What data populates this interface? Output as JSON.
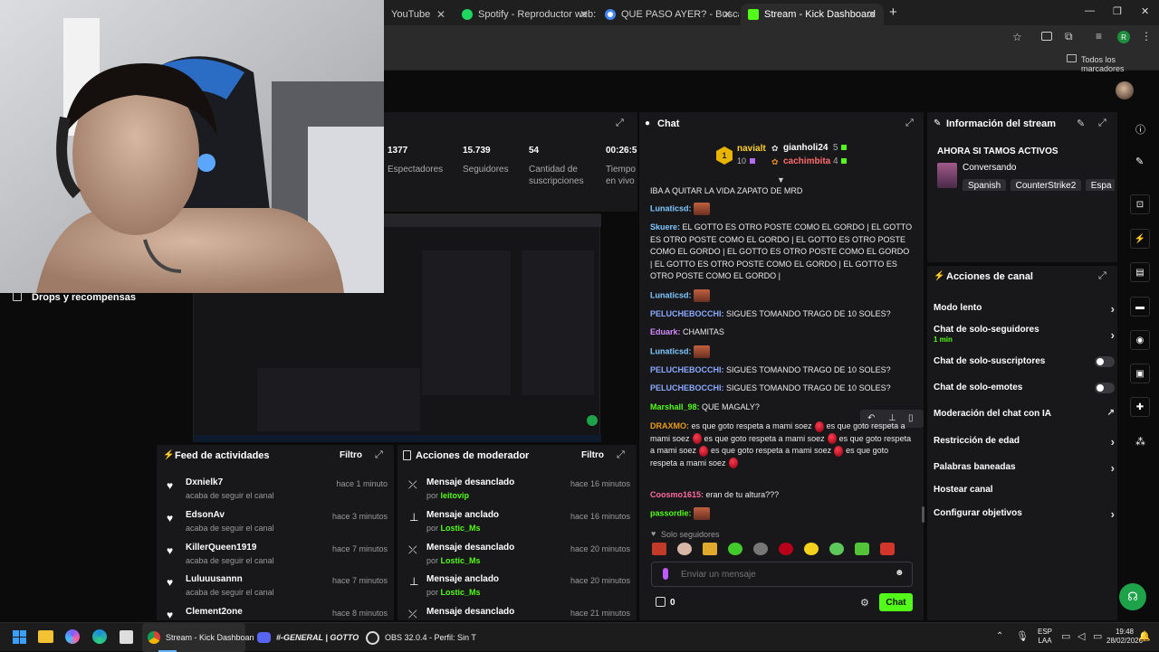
{
  "browser": {
    "tabs": [
      {
        "label": "YouTube"
      },
      {
        "label": "Spotify - Reproductor web: mú"
      },
      {
        "label": "QUE PASO AYER? - Buscar con"
      },
      {
        "label": "Stream - Kick Dashboard"
      }
    ],
    "bookmarks_label": "Todos los marcadores",
    "profile_initial": "R"
  },
  "stats": [
    {
      "value": "1377",
      "label": "Espectadores"
    },
    {
      "value": "15.739",
      "label": "Seguidores"
    },
    {
      "value": "54",
      "label": "Cantidad de suscripciones"
    },
    {
      "value": "00:26:5",
      "label": "Tiempo en vivo"
    }
  ],
  "drops_label": "Drops y recompensas",
  "chat": {
    "title": "Chat",
    "leaderboard": [
      {
        "rank": "1",
        "name": "navialt",
        "count": "10"
      },
      {
        "name": "gianholi24",
        "count": "5"
      },
      {
        "name": "cachimbita",
        "count": "4"
      }
    ],
    "messages": [
      {
        "user": "",
        "text": "IBA A QUITAR LA VIDA ZAPATO DE MRD"
      },
      {
        "user": "Lunaticsd:",
        "text": ""
      },
      {
        "user": "Skuere:",
        "text": "EL GOTTO ES OTRO POSTE COMO EL GORDO | EL GOTTO ES OTRO POSTE COMO EL GORDO | EL GOTTO ES OTRO POSTE COMO EL GORDO | EL GOTTO ES OTRO POSTE COMO EL GORDO | EL GOTTO ES OTRO POSTE COMO EL GORDO | EL GOTTO ES OTRO POSTE COMO EL GORDO |"
      },
      {
        "user": "Lunaticsd:",
        "text": ""
      },
      {
        "user": "PELUCHEBOCCHI:",
        "text": "SIGUES TOMANDO TRAGO DE 10 SOLES?"
      },
      {
        "user": "Eduark:",
        "text": "CHAMITAS"
      },
      {
        "user": "Lunaticsd:",
        "text": ""
      },
      {
        "user": "PELUCHEBOCCHI:",
        "text": "SIGUES TOMANDO TRAGO DE 10 SOLES?"
      },
      {
        "user": "PELUCHEBOCCHI:",
        "text": "SIGUES TOMANDO TRAGO DE 10 SOLES?"
      },
      {
        "user": "Marshall_98:",
        "text": "QUE MAGALY?"
      },
      {
        "user": "DRAXMO:",
        "text": "es que goto respeta a mami soez"
      },
      {
        "user": "Coosmo1615:",
        "text": "eran de tu altura???"
      },
      {
        "user": "passordie:",
        "text": ""
      }
    ],
    "followers_only": "Solo seguidores",
    "input_placeholder": "Enviar un mensaje",
    "points": "0",
    "send_label": "Chat"
  },
  "stream_info": {
    "title": "Información del stream",
    "stream_title": "AHORA SI TAMOS ACTIVOS",
    "category": "Conversando",
    "tags": [
      "Spanish",
      "CounterStrike2",
      "Espa"
    ]
  },
  "channel_actions": {
    "title": "Acciones de canal",
    "items": [
      {
        "label": "Modo lento",
        "control": "chevron"
      },
      {
        "label": "Chat de solo-seguidores",
        "sub": "1 min",
        "control": "chevron"
      },
      {
        "label": "Chat de solo-suscriptores",
        "control": "toggle"
      },
      {
        "label": "Chat de solo-emotes",
        "control": "toggle"
      },
      {
        "label": "Moderación del chat con IA",
        "control": "external"
      },
      {
        "label": "Restricción de edad",
        "control": "chevron"
      },
      {
        "label": "Palabras baneadas",
        "control": "chevron"
      },
      {
        "label": "Hostear canal",
        "control": "none"
      },
      {
        "label": "Configurar objetivos",
        "control": "chevron"
      }
    ]
  },
  "activity_feed": {
    "title": "Feed de actividades",
    "filter": "Filtro",
    "items": [
      {
        "name": "Dxnielk7",
        "action": "acaba de seguir el canal",
        "time": "hace 1 minuto"
      },
      {
        "name": "EdsonAv",
        "action": "acaba de seguir el canal",
        "time": "hace 3 minutos"
      },
      {
        "name": "KillerQueen1919",
        "action": "acaba de seguir el canal",
        "time": "hace 7 minutos"
      },
      {
        "name": "Luluuusannn",
        "action": "acaba de seguir el canal",
        "time": "hace 7 minutos"
      },
      {
        "name": "Clement2one",
        "action": "",
        "time": "hace 8 minutos"
      }
    ]
  },
  "mod_actions": {
    "title": "Acciones de moderador",
    "filter": "Filtro",
    "items": [
      {
        "action": "Mensaje desanclado",
        "by_prefix": "por",
        "by": "leitovip",
        "time": "hace 16 minutos"
      },
      {
        "action": "Mensaje anclado",
        "by_prefix": "por",
        "by": "Lostic_Ms",
        "time": "hace 16 minutos"
      },
      {
        "action": "Mensaje desanclado",
        "by_prefix": "por",
        "by": "Lostic_Ms",
        "time": "hace 20 minutos"
      },
      {
        "action": "Mensaje anclado",
        "by_prefix": "por",
        "by": "Lostic_Ms",
        "time": "hace 20 minutos"
      },
      {
        "action": "Mensaje desanclado",
        "by_prefix": "",
        "by": "",
        "time": "hace 21 minutos"
      }
    ]
  },
  "taskbar": {
    "apps": [
      {
        "label": "Stream - Kick Dashboan"
      },
      {
        "label": "#-GENERAL | GOTTO"
      },
      {
        "label": "OBS 32.0.4 - Perfil: Sin T"
      }
    ],
    "lang_top": "ESP",
    "lang_bottom": "LAA",
    "time": "19:48",
    "date": "28/02/2026"
  },
  "colors": {
    "kick_green": "#53fc18",
    "panel_bg": "#18181b",
    "page_bg": "#0b0b0c"
  }
}
